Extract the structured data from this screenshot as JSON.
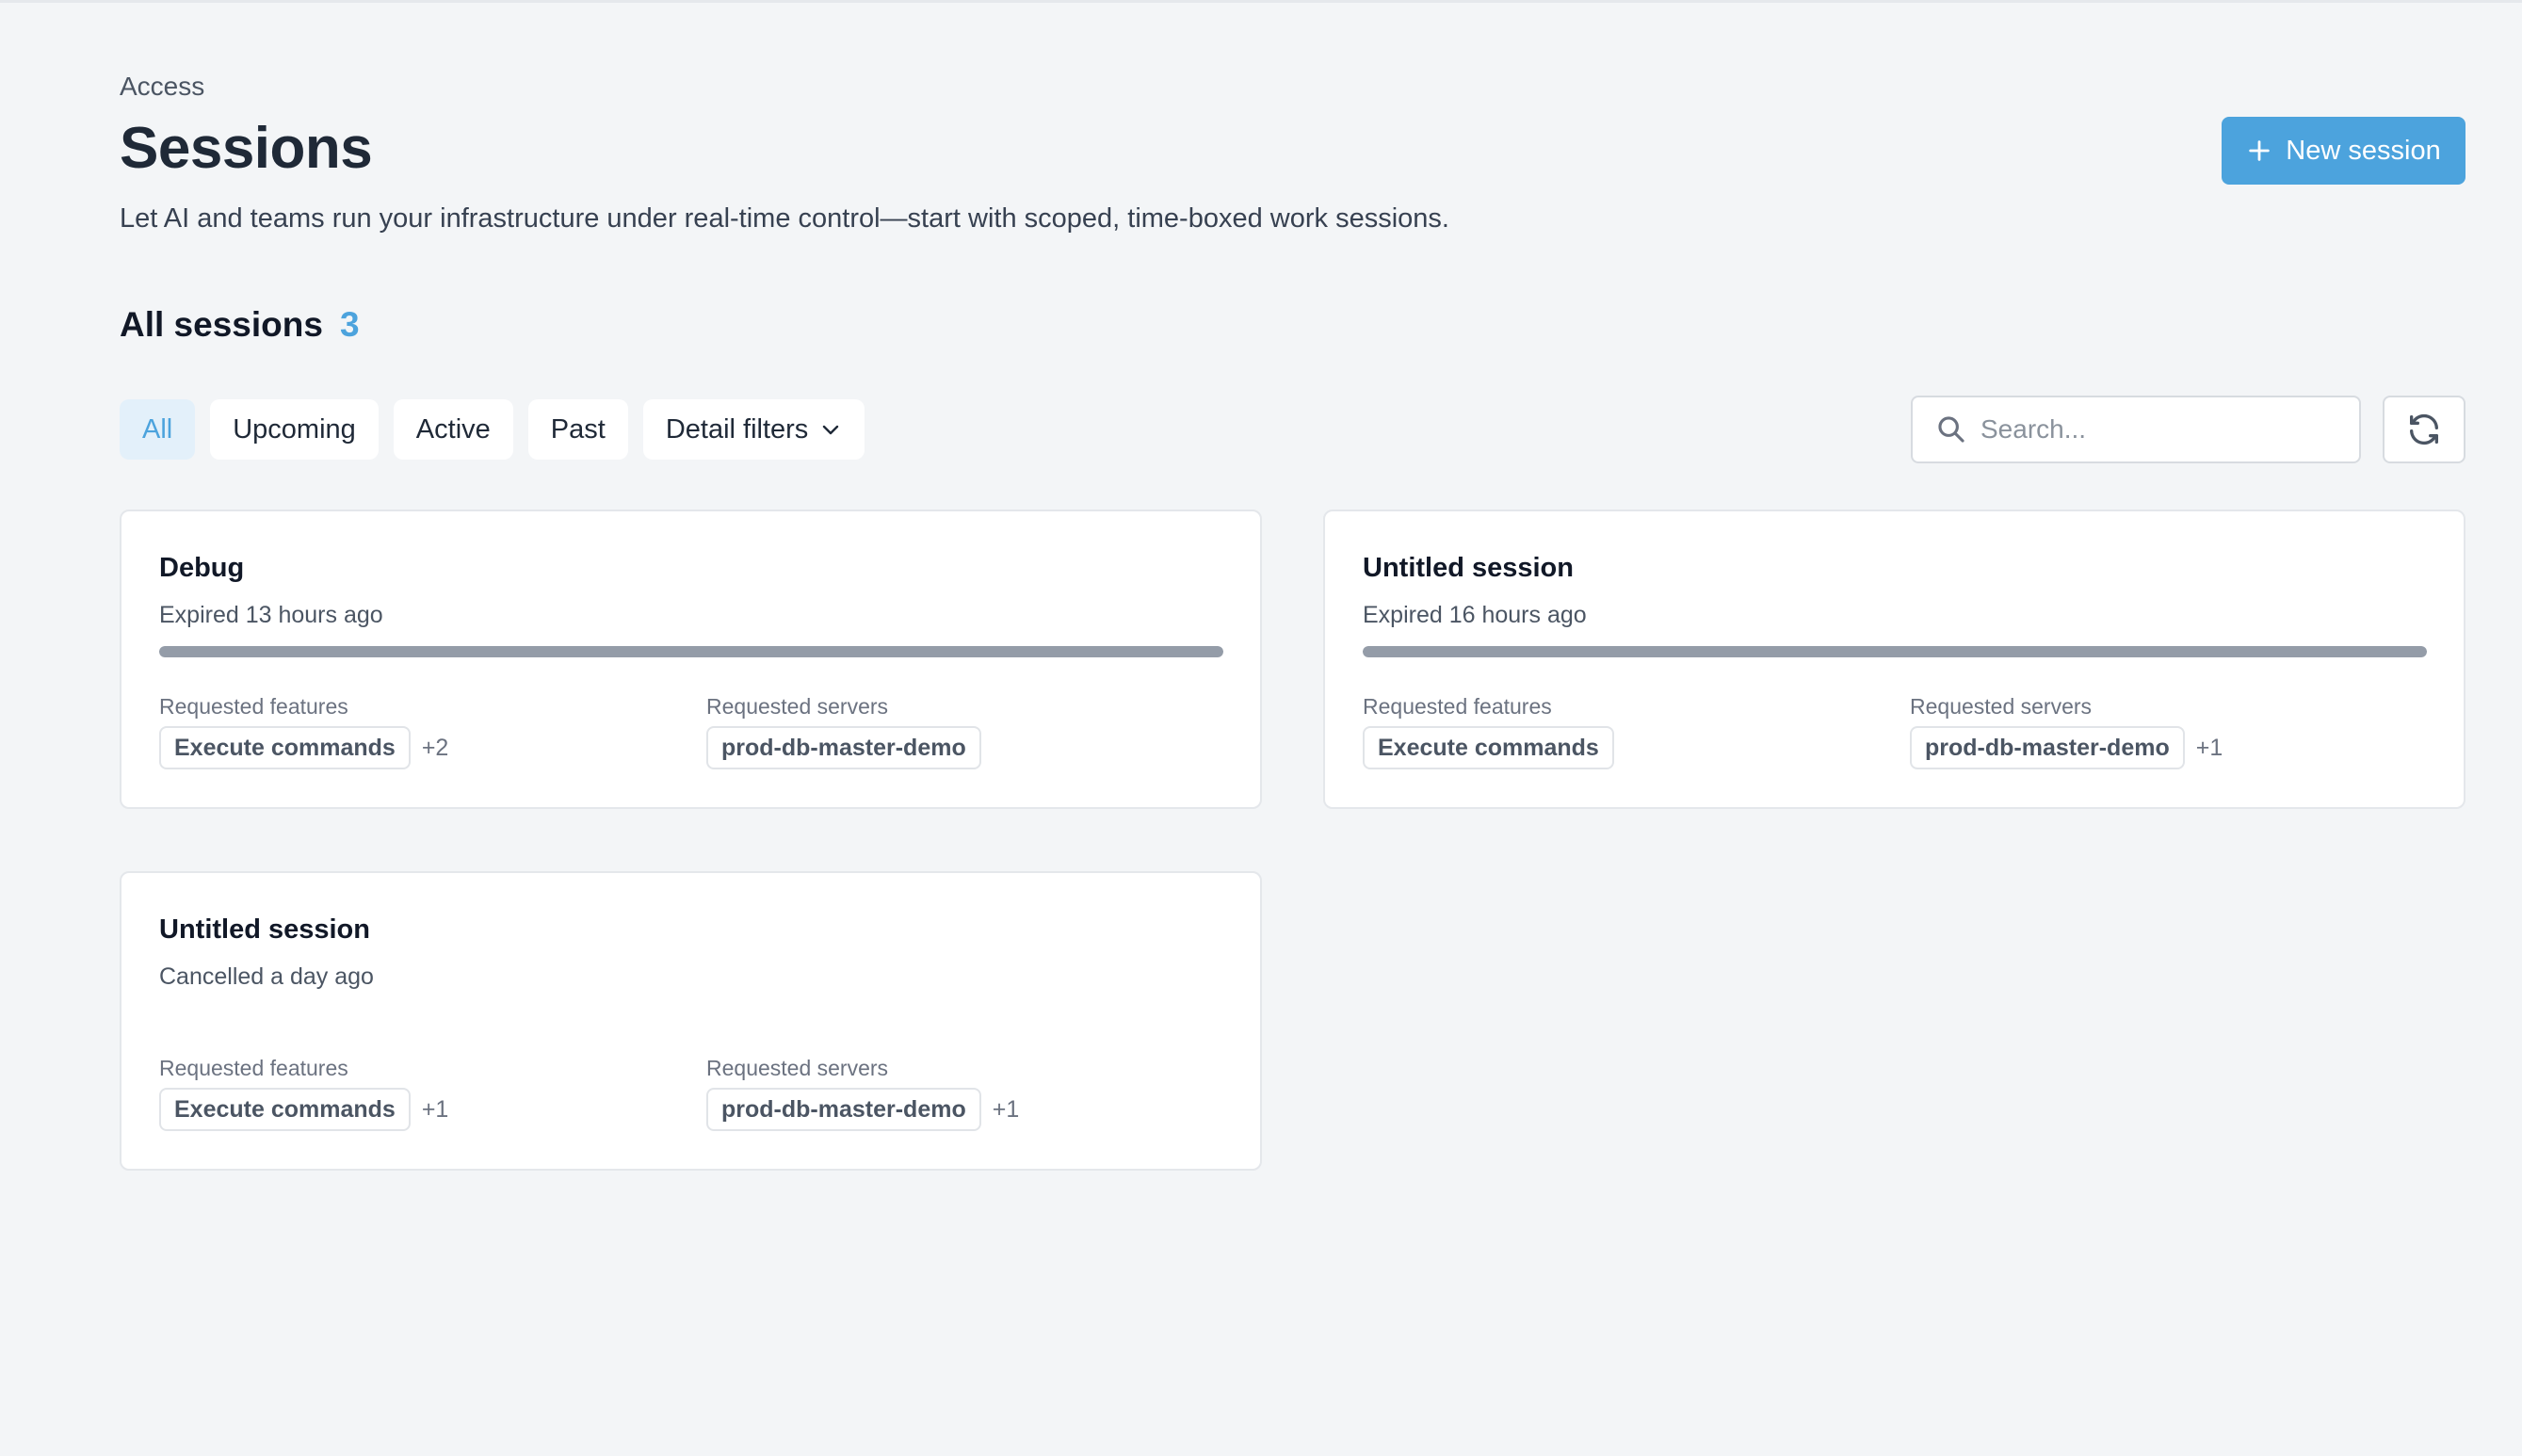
{
  "header": {
    "breadcrumb": "Access",
    "title": "Sessions",
    "subtitle": "Let AI and teams run your infrastructure under real-time control—start with scoped, time-boxed work sessions.",
    "new_button_label": "New session"
  },
  "section": {
    "title": "All sessions",
    "count": "3"
  },
  "filters": {
    "chips": [
      "All",
      "Upcoming",
      "Active",
      "Past"
    ],
    "selected": "All",
    "detail_filters_label": "Detail filters"
  },
  "search": {
    "placeholder": "Search...",
    "value": ""
  },
  "labels": {
    "features": "Requested features",
    "servers": "Requested servers"
  },
  "sessions": [
    {
      "title": "Debug",
      "status": "Expired 13 hours ago",
      "progress": 1.0,
      "features": "Execute commands",
      "features_more": "+2",
      "servers": "prod-db-master-demo",
      "servers_more": ""
    },
    {
      "title": "Untitled session",
      "status": "Expired 16 hours ago",
      "progress": 1.0,
      "features": "Execute commands",
      "features_more": "",
      "servers": "prod-db-master-demo",
      "servers_more": "+1"
    },
    {
      "title": "Untitled session",
      "status": "Cancelled a day ago",
      "progress": null,
      "features": "Execute commands",
      "features_more": "+1",
      "servers": "prod-db-master-demo",
      "servers_more": "+1"
    }
  ],
  "colors": {
    "accent": "#4ca3dd",
    "background": "#f3f5f7",
    "bar_fill": "#949ca8"
  },
  "icons": {
    "new_button": "plus-icon",
    "search": "search-icon",
    "refresh": "refresh-icon",
    "detail_filters": "chevron-down-icon"
  }
}
